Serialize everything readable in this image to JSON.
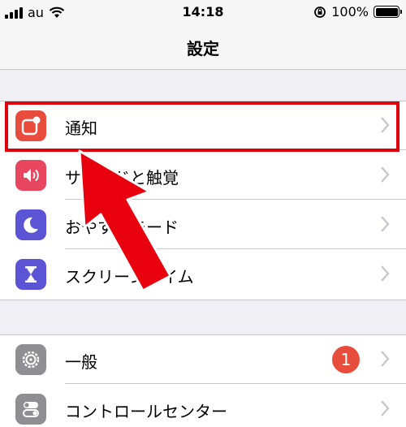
{
  "status_bar": {
    "carrier": "au",
    "time": "14:18",
    "battery": "100%"
  },
  "nav": {
    "title": "設定"
  },
  "groups": [
    {
      "items": [
        {
          "label": "通知",
          "icon": "notifications-icon",
          "color": "#e84c3d"
        },
        {
          "label": "サウンドと触覚",
          "icon": "sound-icon",
          "color": "#e8455e"
        },
        {
          "label": "おやすみモード",
          "icon": "moon-icon",
          "color": "#5b55d6"
        },
        {
          "label": "スクリーンタイム",
          "icon": "hourglass-icon",
          "color": "#5b55d6"
        }
      ]
    },
    {
      "items": [
        {
          "label": "一般",
          "icon": "gear-icon",
          "color": "#8e8e93",
          "badge": "1"
        },
        {
          "label": "コントロールセンター",
          "icon": "toggles-icon",
          "color": "#8e8e93"
        }
      ]
    }
  ],
  "annotation": {
    "highlight_color": "#e0000c",
    "arrow_color": "#e8000e"
  }
}
